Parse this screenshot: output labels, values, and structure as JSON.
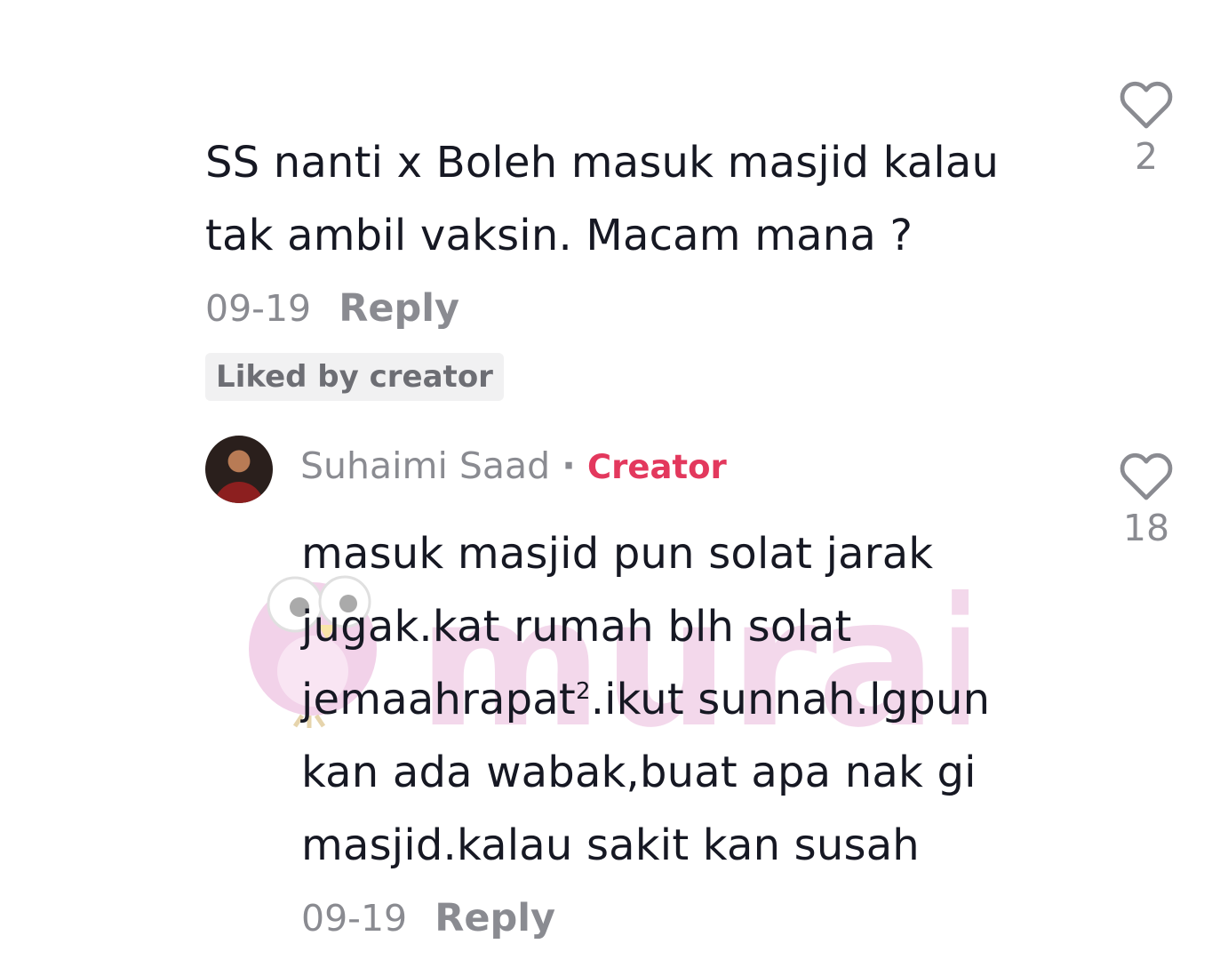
{
  "comment": {
    "text_line1": "SS nanti x Boleh masuk masjid kalau",
    "text_line2": "tak ambil vaksin. Macam mana ?",
    "date": "09-19",
    "reply_label": "Reply",
    "liked_badge": "Liked by creator",
    "like_count": "2"
  },
  "reply": {
    "username": "Suhaimi Saad",
    "separator": "·",
    "creator_label": "Creator",
    "text_line1": "masuk masjid pun solat jarak",
    "text_line2": "jugak.kat rumah blh solat",
    "text_line3a": "jemaahrapat",
    "text_line3sup": "2",
    "text_line3b": ".ikut sunnah.lgpun",
    "text_line4": "kan ada wabak,buat apa nak gi",
    "text_line5": "masjid.kalau sakit kan susah",
    "date": "09-19",
    "reply_label": "Reply",
    "like_count": "18"
  },
  "watermark": {
    "text": "murai"
  },
  "colors": {
    "text": "#161823",
    "secondary": "#8a8b91",
    "creator_accent": "#e3385d",
    "badge_bg": "#f1f1f2"
  },
  "icons": {
    "like": "heart-outline-icon",
    "watermark_logo": "owl-logo-icon"
  }
}
